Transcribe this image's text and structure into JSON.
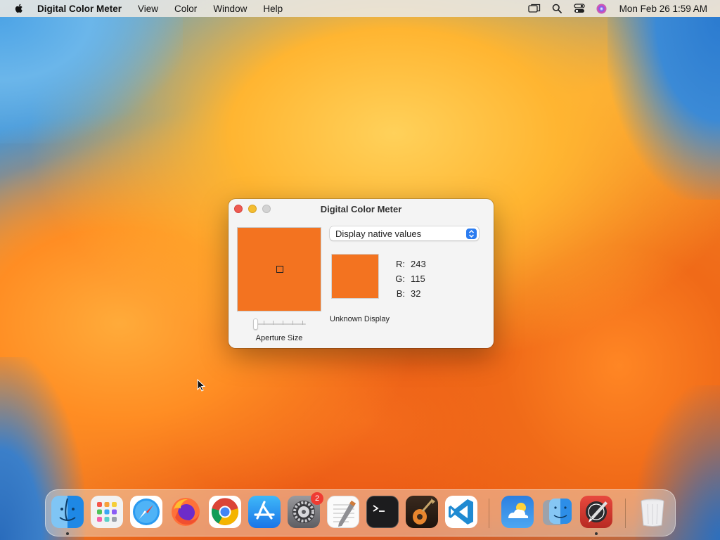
{
  "menubar": {
    "app_name": "Digital Color Meter",
    "items": [
      "View",
      "Color",
      "Window",
      "Help"
    ],
    "clock": "Mon Feb 26  1:59 AM"
  },
  "window": {
    "title": "Digital Color Meter",
    "display_mode": "Display native values",
    "sample_color": "#f37320",
    "rgb": {
      "r_label": "R:",
      "r": "243",
      "g_label": "G:",
      "g": "115",
      "b_label": "B:",
      "b": "32"
    },
    "display_name": "Unknown Display",
    "aperture_label": "Aperture Size",
    "aperture_slider_value": 0.0
  },
  "dock": {
    "items": [
      {
        "name": "Finder",
        "icon": "finder-icon",
        "running": true
      },
      {
        "name": "Launchpad",
        "icon": "launchpad-icon",
        "running": false
      },
      {
        "name": "Safari",
        "icon": "safari-icon",
        "running": false
      },
      {
        "name": "Firefox",
        "icon": "firefox-icon",
        "running": false
      },
      {
        "name": "Google Chrome",
        "icon": "chrome-icon",
        "running": false
      },
      {
        "name": "App Store",
        "icon": "app-store-icon",
        "running": false
      },
      {
        "name": "System Settings",
        "icon": "system-settings-icon",
        "running": false,
        "badge": "2"
      },
      {
        "name": "TextEdit",
        "icon": "textedit-icon",
        "running": false
      },
      {
        "name": "Terminal",
        "icon": "terminal-icon",
        "running": false
      },
      {
        "name": "GarageBand",
        "icon": "garageband-icon",
        "running": false
      },
      {
        "name": "Visual Studio Code",
        "icon": "vscode-icon",
        "running": false
      },
      {
        "name": "Weather",
        "icon": "weather-icon",
        "running": false
      },
      {
        "name": "Migration Assistant",
        "icon": "migration-assistant-icon",
        "running": false
      },
      {
        "name": "Digital Color Meter",
        "icon": "digital-color-meter-icon",
        "running": true
      },
      {
        "name": "Trash",
        "icon": "trash-icon",
        "running": false
      }
    ]
  }
}
